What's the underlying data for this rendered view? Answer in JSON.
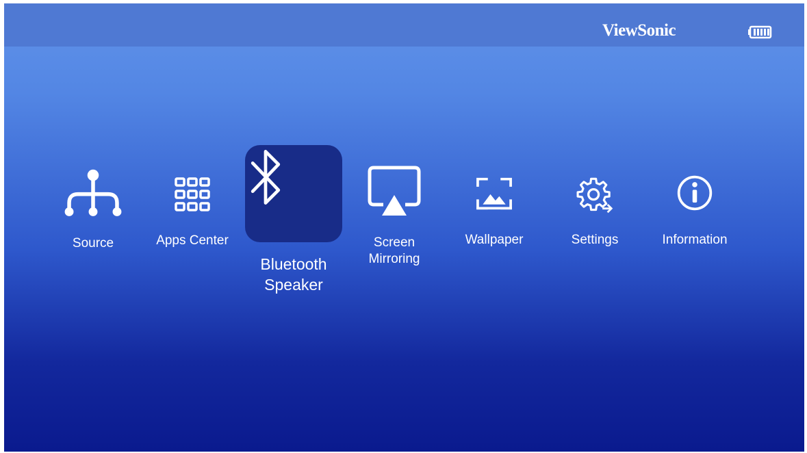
{
  "header": {
    "brand": "ViewSonic",
    "battery_icon": "battery-icon"
  },
  "menu": {
    "selected": "Bluetooth Speaker",
    "items": [
      {
        "label": "Source",
        "icon": "source-tree-icon"
      },
      {
        "label": "Apps Center",
        "icon": "apps-grid-icon"
      },
      {
        "label_line1": "Bluetooth",
        "label_line2": "Speaker",
        "icon": "bluetooth-icon"
      },
      {
        "label_line1": "Screen",
        "label_line2": "Mirroring",
        "icon": "screen-mirroring-icon"
      },
      {
        "label": "Wallpaper",
        "icon": "wallpaper-icon"
      },
      {
        "label": "Settings",
        "icon": "gear-icon"
      },
      {
        "label": "Information",
        "icon": "info-icon"
      }
    ]
  },
  "colors": {
    "header_bar": "#4f79d3",
    "gradient_top": "#6193e9",
    "gradient_bottom": "#0a1a8e",
    "selected_tile": "#182c88",
    "text": "#ffffff"
  }
}
